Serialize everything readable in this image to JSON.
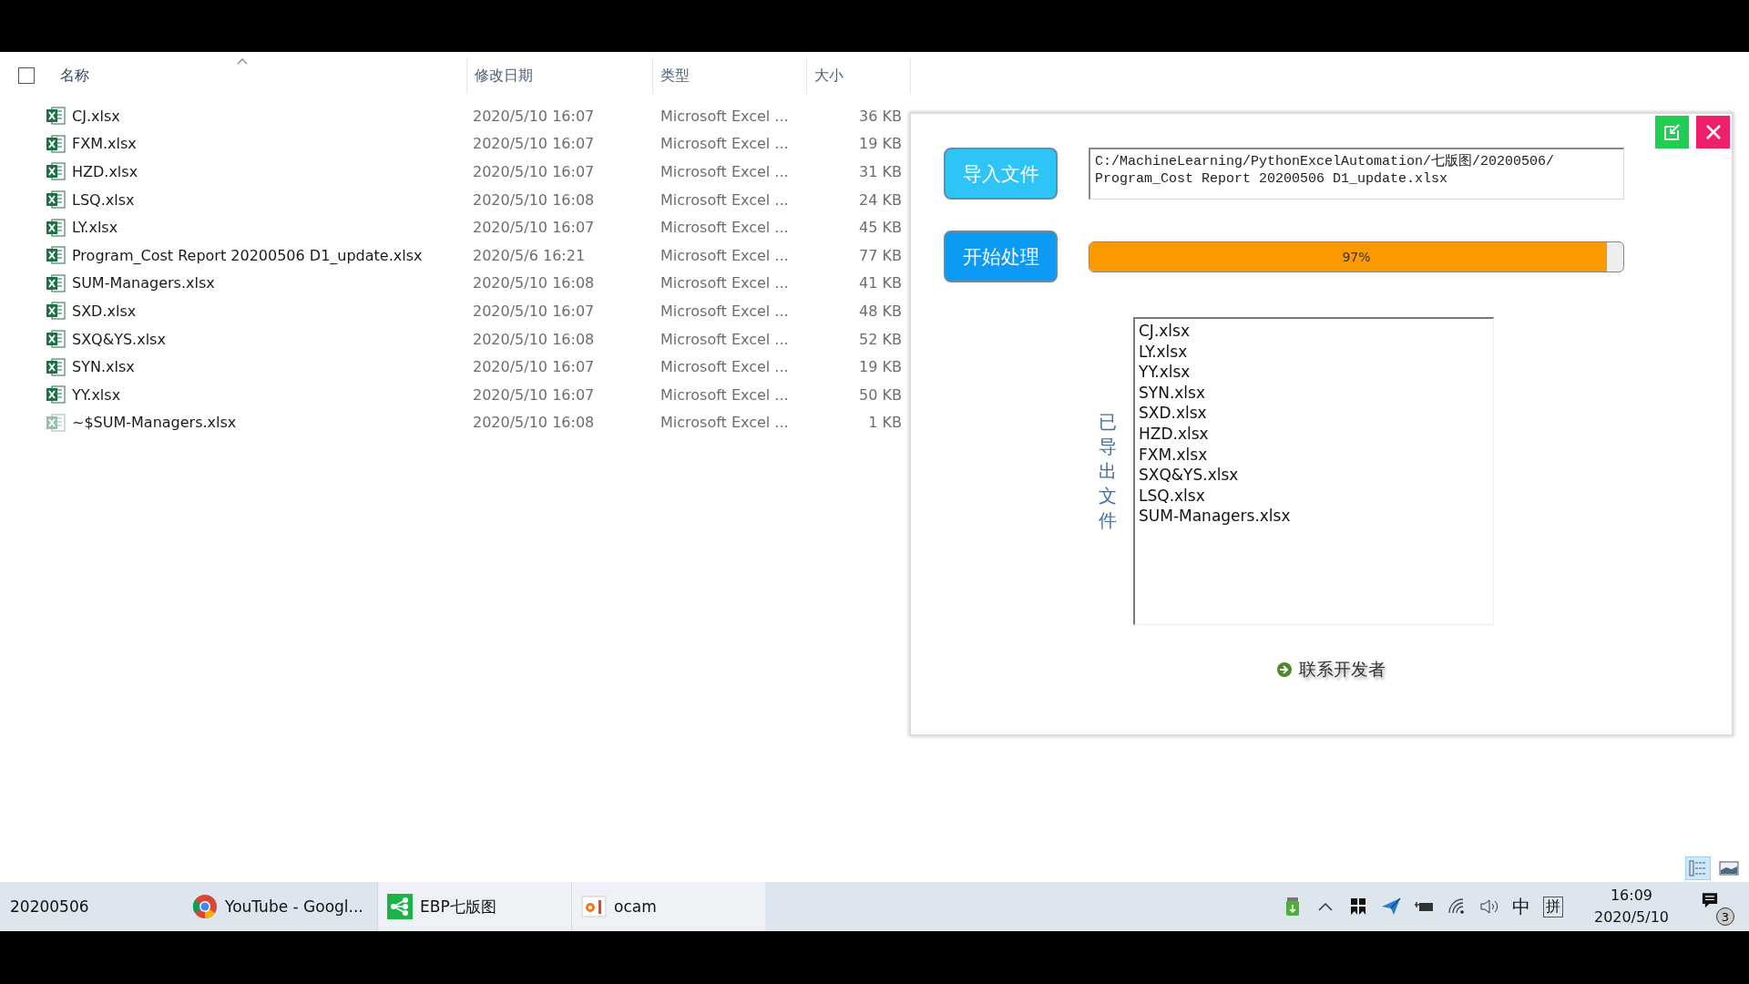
{
  "explorer": {
    "select_all": {
      "checked": false
    },
    "columns": [
      {
        "label": "名称",
        "sorted": true
      },
      {
        "label": "修改日期",
        "sorted": false
      },
      {
        "label": "类型",
        "sorted": false
      },
      {
        "label": "大小",
        "sorted": false
      }
    ],
    "files": [
      {
        "name": "CJ.xlsx",
        "date": "2020/5/10 16:07",
        "type": "Microsoft Excel ...",
        "size": "36 KB",
        "kind": "excel"
      },
      {
        "name": "FXM.xlsx",
        "date": "2020/5/10 16:07",
        "type": "Microsoft Excel ...",
        "size": "19 KB",
        "kind": "excel"
      },
      {
        "name": "HZD.xlsx",
        "date": "2020/5/10 16:07",
        "type": "Microsoft Excel ...",
        "size": "31 KB",
        "kind": "excel"
      },
      {
        "name": "LSQ.xlsx",
        "date": "2020/5/10 16:08",
        "type": "Microsoft Excel ...",
        "size": "24 KB",
        "kind": "excel"
      },
      {
        "name": "LY.xlsx",
        "date": "2020/5/10 16:07",
        "type": "Microsoft Excel ...",
        "size": "45 KB",
        "kind": "excel"
      },
      {
        "name": "Program_Cost Report 20200506 D1_update.xlsx",
        "date": "2020/5/6 16:21",
        "type": "Microsoft Excel ...",
        "size": "77 KB",
        "kind": "excel"
      },
      {
        "name": "SUM-Managers.xlsx",
        "date": "2020/5/10 16:08",
        "type": "Microsoft Excel ...",
        "size": "41 KB",
        "kind": "excel"
      },
      {
        "name": "SXD.xlsx",
        "date": "2020/5/10 16:07",
        "type": "Microsoft Excel ...",
        "size": "48 KB",
        "kind": "excel"
      },
      {
        "name": "SXQ&YS.xlsx",
        "date": "2020/5/10 16:08",
        "type": "Microsoft Excel ...",
        "size": "52 KB",
        "kind": "excel"
      },
      {
        "name": "SYN.xlsx",
        "date": "2020/5/10 16:07",
        "type": "Microsoft Excel ...",
        "size": "19 KB",
        "kind": "excel"
      },
      {
        "name": "YY.xlsx",
        "date": "2020/5/10 16:07",
        "type": "Microsoft Excel ...",
        "size": "50 KB",
        "kind": "excel"
      },
      {
        "name": "~$SUM-Managers.xlsx",
        "date": "2020/5/10 16:08",
        "type": "Microsoft Excel ...",
        "size": "1 KB",
        "kind": "temp"
      }
    ],
    "views": [
      {
        "kind": "details",
        "selected": true
      },
      {
        "kind": "thumbnails",
        "selected": false
      }
    ]
  },
  "dialog": {
    "import_button": "导入文件",
    "path_field": {
      "lines": [
        "C:/MachineLearning/PythonExcelAutomation/七版图/20200506/",
        "Program_Cost Report 20200506 D1_update.xlsx"
      ]
    },
    "start_button": "开始处理",
    "progress": {
      "level": 0.97,
      "reading": "97%"
    },
    "exported_label": "已导出文件",
    "exported_files": [
      "CJ.xlsx",
      "LY.xlsx",
      "YY.xlsx",
      "SYN.xlsx",
      "SXD.xlsx",
      "HZD.xlsx",
      "FXM.xlsx",
      "SXQ&YS.xlsx",
      "LSQ.xlsx",
      "SUM-Managers.xlsx"
    ],
    "contact_link": "联系开发者"
  },
  "taskbar": {
    "folder": "20200506",
    "apps": [
      {
        "label": "YouTube - Googl...",
        "kind": "chrome",
        "highlighted": false
      },
      {
        "label": "EBP七版图",
        "kind": "ebp",
        "highlighted": true
      },
      {
        "label": "ocam",
        "kind": "ocam",
        "highlighted": true
      }
    ],
    "ime_mode": "中",
    "ime_name": "拼",
    "time": "16:09",
    "date": "2020/5/10",
    "notifications": "3"
  }
}
